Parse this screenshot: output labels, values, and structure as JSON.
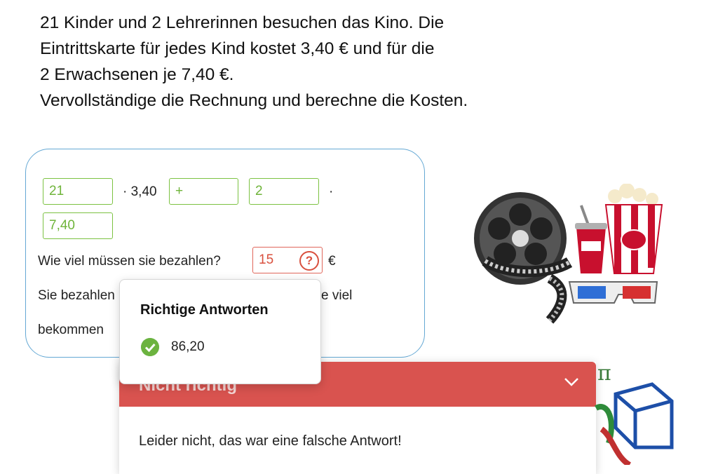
{
  "task": {
    "line1": "21 Kinder und 2 Lehrerinnen besuchen das Kino. Die",
    "line2": "Eintrittskarte für jedes Kind kostet 3,40 € und für die",
    "line3": "2 Erwachsenen je 7,40 €.",
    "line4": "Vervollständige die Rechnung und berechne die Kosten."
  },
  "exercise": {
    "field1_value": "21",
    "op1_text": "· 3,40",
    "field2_value": "+",
    "field3_value": "2",
    "op2_text": "·",
    "field4_value": "7,40",
    "question": "Wie viel müssen sie bezahlen?",
    "answer_value": "15",
    "answer_unit": "€",
    "line2_start": "Sie bezahlen",
    "line2_end": "e viel",
    "line3_start": "bekommen"
  },
  "popover": {
    "title": "Richtige Antworten",
    "answer": "86,20"
  },
  "feedback": {
    "title": "Nicht richtig",
    "message": "Leider nicht, das war eine falsche Antwort!"
  },
  "icons": {
    "help": "question-circle-icon",
    "check": "check-circle-icon",
    "chevron": "chevron-down-icon"
  },
  "colors": {
    "correct": "#7cc242",
    "wrong": "#d9534f",
    "box_border": "#64a8d4"
  }
}
